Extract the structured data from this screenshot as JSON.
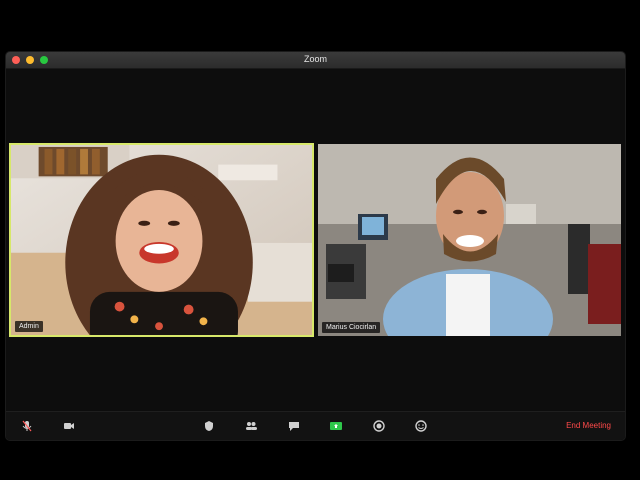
{
  "window": {
    "title": "Zoom"
  },
  "participants": [
    {
      "name": "Admin",
      "active_speaker": true
    },
    {
      "name": "Marius Ciocirlan",
      "active_speaker": false
    }
  ],
  "toolbar": {
    "icons": [
      "mic-muted-icon",
      "video-icon",
      "security-icon",
      "participants-icon",
      "chat-icon",
      "share-screen-icon",
      "record-icon",
      "reactions-icon"
    ],
    "end_label": "End Meeting"
  },
  "colors": {
    "active_border": "#d7e86a",
    "end_meeting": "#ff4a4a",
    "share": "#2ec74b"
  }
}
